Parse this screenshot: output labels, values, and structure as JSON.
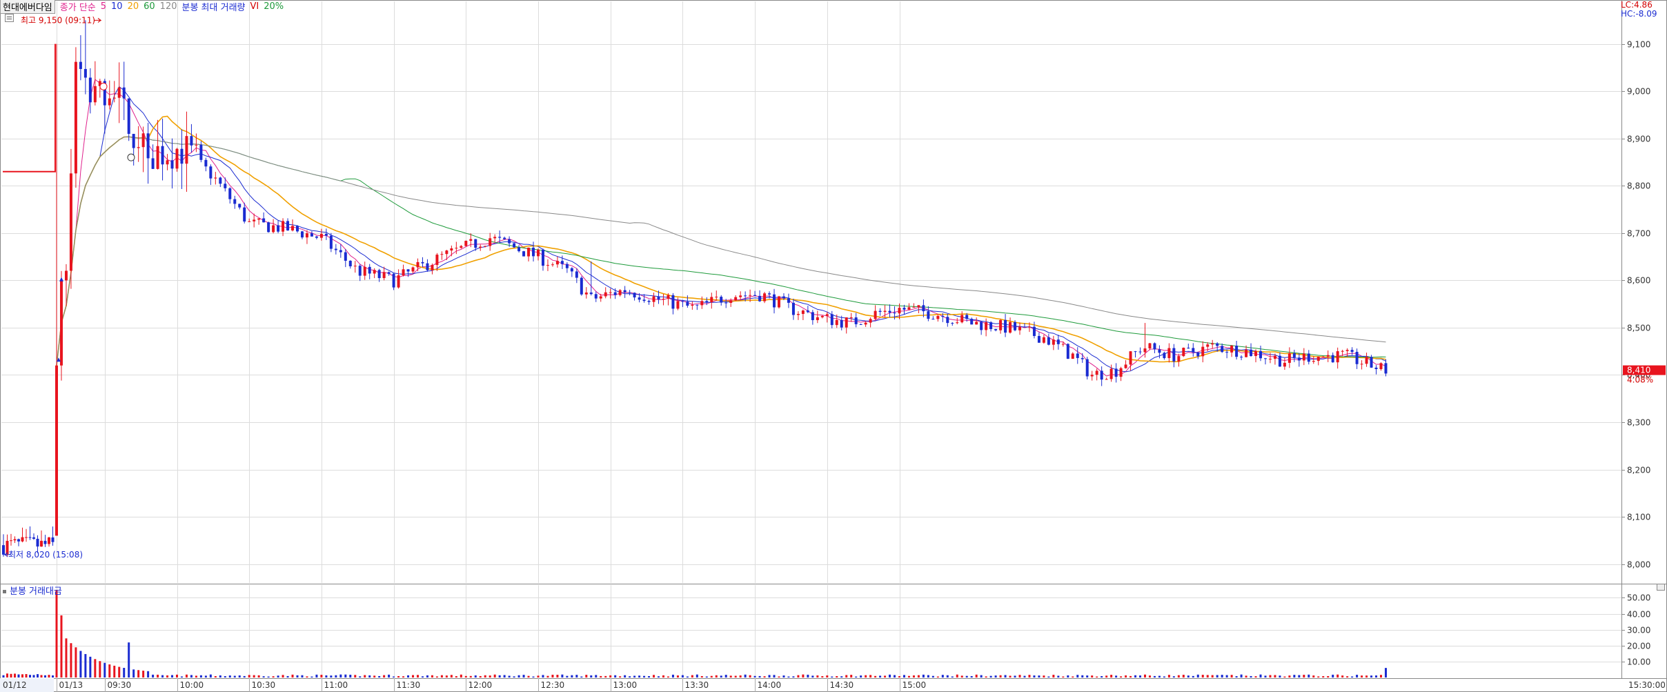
{
  "header": {
    "stock": "현대에버다임",
    "ma_label": "종가 단순",
    "ma_periods": [
      "5",
      "10",
      "20",
      "60",
      "120"
    ],
    "ma_colors": [
      "#e0208c",
      "#1a2bd1",
      "#f0a000",
      "#1d9a3a",
      "#888888"
    ],
    "vol_max_label": "분봉 최대 거래량",
    "vi_label": "VI",
    "vi_value": "20%"
  },
  "corner": {
    "lc": "LC:4.86",
    "hc": "HC:-8.09"
  },
  "volume_panel": {
    "title": "분봉 거래대금"
  },
  "colors": {
    "up": "#e8141e",
    "down": "#1a2bd1",
    "grid": "#dcdcdc",
    "price_badge": "#e8141e"
  },
  "chart_data": {
    "type": "candlestick",
    "price_axis": {
      "ticks": [
        "8,000",
        "8,100",
        "8,200",
        "8,300",
        "8,400",
        "8,500",
        "8,600",
        "8,700",
        "8,800",
        "8,900",
        "9,000",
        "9,100"
      ],
      "ylim": [
        7960,
        9190
      ]
    },
    "volume_axis": {
      "ticks": [
        "10.00",
        "20.00",
        "30.00",
        "40.00",
        "50.00"
      ],
      "ylim": [
        0,
        58
      ]
    },
    "time_labels": [
      "01/12",
      "01/13",
      "09:30",
      "10:00",
      "10:30",
      "11:00",
      "11:30",
      "12:00",
      "12:30",
      "13:00",
      "13:30",
      "14:00",
      "14:30",
      "15:00",
      "15:30:00"
    ],
    "annotations": {
      "high": {
        "text": "최고 9,150 (09:11)",
        "value": 9150
      },
      "low": {
        "text": "최저 8,020 (15:08)",
        "value": 8020
      }
    },
    "current_price": {
      "value": 8410,
      "label": "8,410",
      "change": "4.08%"
    },
    "prev_close": 8830,
    "vi_levels": [
      8000,
      8100,
      8600,
      9150
    ],
    "keypoints": [
      [
        -40,
        8040
      ],
      [
        0,
        8060
      ],
      [
        3,
        8500
      ],
      [
        8,
        9050
      ],
      [
        15,
        8980
      ],
      [
        22,
        9010
      ],
      [
        30,
        8930
      ],
      [
        40,
        8870
      ],
      [
        52,
        8880
      ],
      [
        65,
        8820
      ],
      [
        80,
        8720
      ],
      [
        95,
        8710
      ],
      [
        110,
        8690
      ],
      [
        125,
        8620
      ],
      [
        140,
        8600
      ],
      [
        160,
        8650
      ],
      [
        180,
        8690
      ],
      [
        200,
        8650
      ],
      [
        212,
        8620
      ],
      [
        222,
        8560
      ],
      [
        236,
        8580
      ],
      [
        250,
        8560
      ],
      [
        265,
        8540
      ],
      [
        280,
        8570
      ],
      [
        293,
        8570
      ],
      [
        305,
        8540
      ],
      [
        318,
        8520
      ],
      [
        330,
        8510
      ],
      [
        340,
        8530
      ],
      [
        350,
        8540
      ],
      [
        365,
        8530
      ],
      [
        380,
        8510
      ],
      [
        395,
        8500
      ],
      [
        410,
        8480
      ],
      [
        422,
        8440
      ],
      [
        430,
        8400
      ],
      [
        440,
        8410
      ],
      [
        451,
        8460
      ],
      [
        465,
        8440
      ],
      [
        480,
        8460
      ],
      [
        495,
        8450
      ],
      [
        510,
        8430
      ],
      [
        520,
        8440
      ],
      [
        535,
        8440
      ],
      [
        546,
        8420
      ],
      [
        552,
        8410
      ]
    ]
  }
}
